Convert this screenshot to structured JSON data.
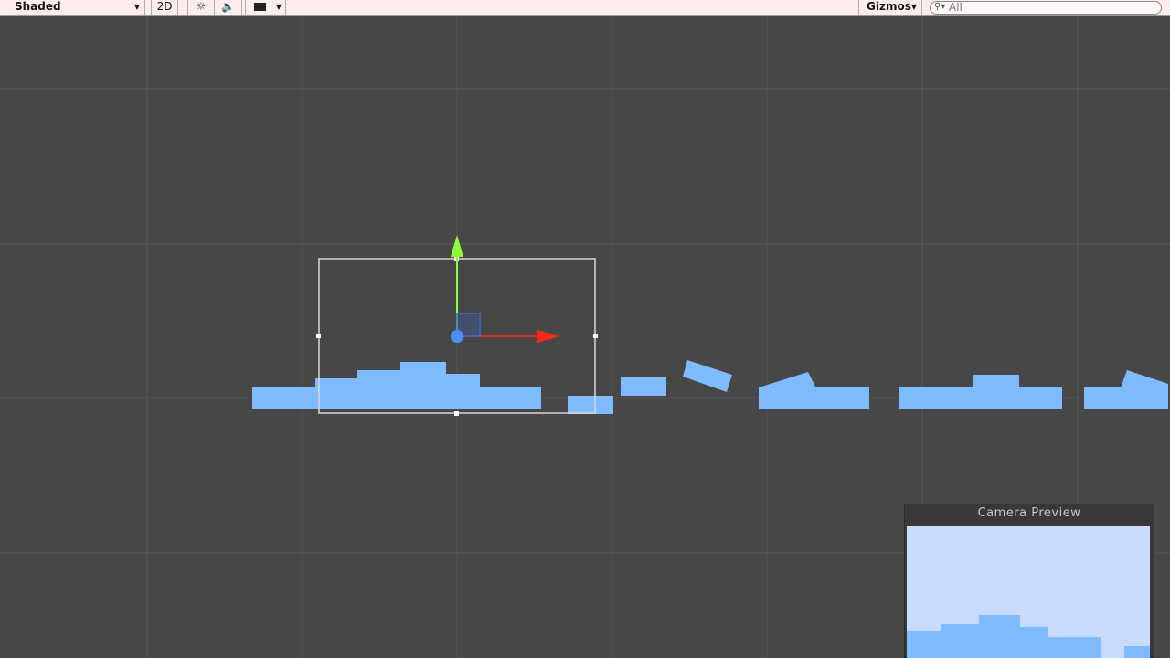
{
  "toolbar": {
    "shading_mode": "Shaded",
    "mode_2d": "2D",
    "gizmos": "Gizmos",
    "search_value": "All",
    "icons": [
      "sun-icon",
      "speaker-icon",
      "image-icon"
    ]
  },
  "preview": {
    "title": "Camera Preview"
  },
  "colors": {
    "background": "#474747",
    "grid": "#5a5a5a",
    "platform": "#7fbcff",
    "y_handle": "#8cff3a",
    "x_handle": "#ff2a1a",
    "z_handle": "#3a68d6",
    "preview_sky": "#c9dcff",
    "preview_ground": "#7fbcff"
  }
}
